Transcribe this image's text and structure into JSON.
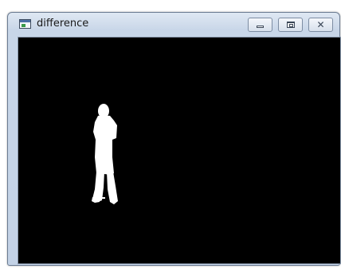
{
  "window": {
    "title": "difference"
  },
  "controls": {
    "minimize": "minimize",
    "maximize": "maximize",
    "close": "close"
  },
  "icons": {
    "app": "window-app-icon",
    "minimize": "minimize-icon",
    "maximize": "maximize-icon",
    "close": "close-icon"
  },
  "colors": {
    "canvas": "#000000",
    "foreground": "#ffffff",
    "chrome": "#c8d6e8"
  }
}
